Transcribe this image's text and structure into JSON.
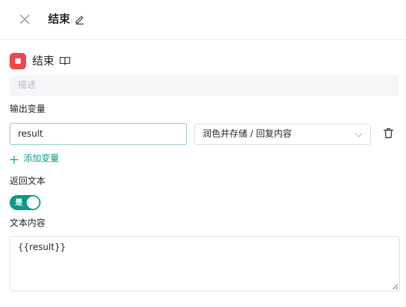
{
  "header": {
    "title": "结束",
    "close_icon": "close-icon",
    "edit_icon": "pencil-icon"
  },
  "node": {
    "icon": "stop-square-icon",
    "icon_color": "#f0474d",
    "title": "结束",
    "doc_icon": "book-icon",
    "description_placeholder": "描述",
    "description_value": ""
  },
  "output_vars": {
    "label": "输出变量",
    "items": [
      {
        "name": "result",
        "source": "润色并存储 / 回复内容"
      }
    ],
    "add_label": "添加变量"
  },
  "return_text": {
    "label": "返回文本",
    "toggle_on": true,
    "toggle_label": "是"
  },
  "text_content": {
    "label": "文本内容",
    "value": "{{result}}"
  },
  "colors": {
    "accent": "#0e9a88",
    "danger": "#f0474d"
  }
}
